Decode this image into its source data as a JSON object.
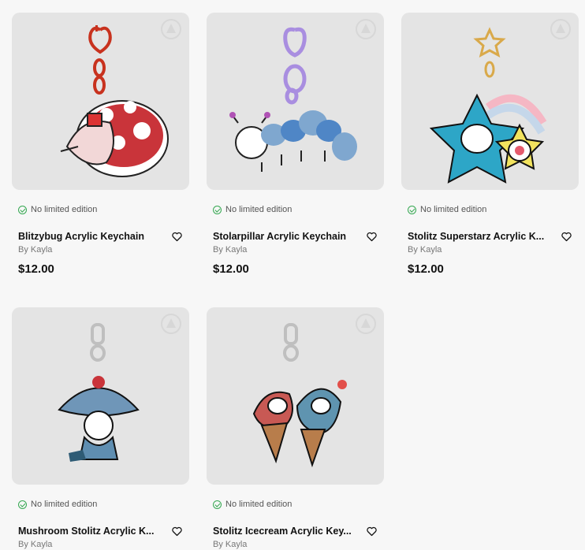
{
  "products": [
    {
      "title": "Blitzybug Acrylic Keychain",
      "edition": "No limited edition",
      "by": "By Kayla",
      "price": "$12.00",
      "art": "ladybug-keychain"
    },
    {
      "title": "Stolarpillar Acrylic Keychain",
      "edition": "No limited edition",
      "by": "By Kayla",
      "price": "$12.00",
      "art": "caterpillar-keychain"
    },
    {
      "title": "Stolitz Superstarz Acrylic K...",
      "edition": "No limited edition",
      "by": "By Kayla",
      "price": "$12.00",
      "art": "star-keychain"
    },
    {
      "title": "Mushroom Stolitz Acrylic K...",
      "edition": "No limited edition",
      "by": "By Kayla",
      "price": "",
      "art": "mushroom-keychain"
    },
    {
      "title": "Stolitz Icecream Acrylic Key...",
      "edition": "No limited edition",
      "by": "By Kayla",
      "price": "",
      "art": "icecream-keychain"
    }
  ],
  "colors": {
    "accent_check": "#36a852",
    "card_bg": "#e4e4e4",
    "page_bg": "#f7f7f7"
  }
}
